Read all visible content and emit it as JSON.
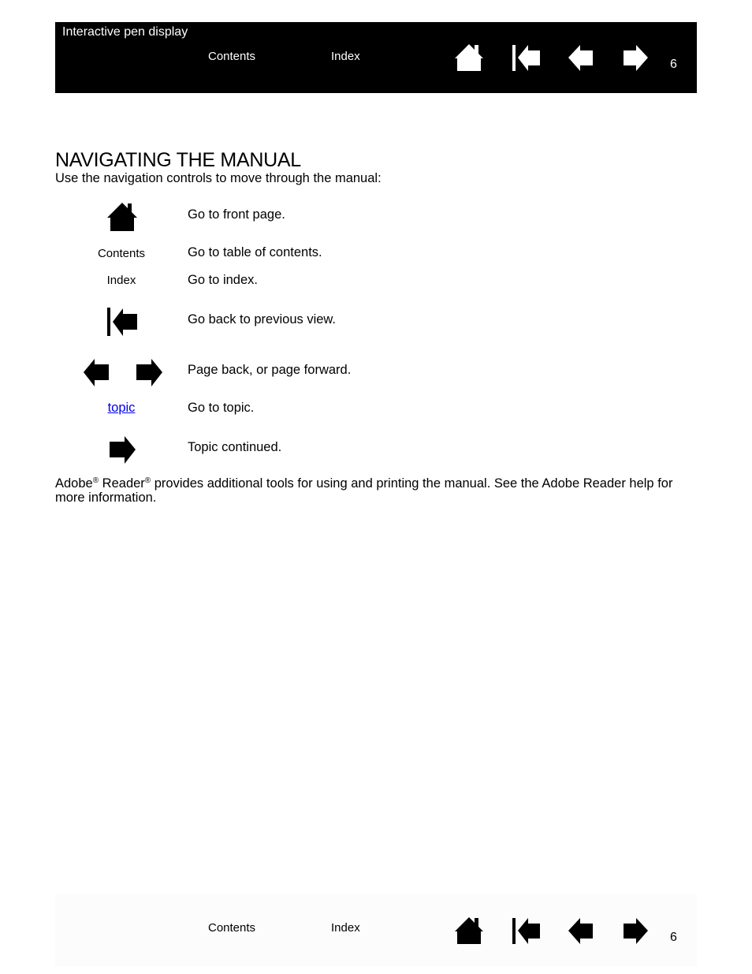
{
  "header": {
    "title": "Interactive pen display",
    "contents_label": "Contents",
    "index_label": "Index",
    "icons": [
      "home-icon",
      "back-view-icon",
      "previous-page-icon",
      "next-page-icon"
    ],
    "page_number": "6"
  },
  "main": {
    "heading": "NAVIGATING THE MANUAL",
    "intro": "Use the navigation controls to move through the manual:",
    "rows": [
      {
        "control": "home-icon",
        "description": "Go to front page."
      },
      {
        "control": "Contents",
        "description": "Go to table of contents."
      },
      {
        "control": "Index",
        "description": "Go to index."
      },
      {
        "control": "back-view-icon",
        "description": "Go back to previous view."
      },
      {
        "control": "previous-next-page-icons",
        "description": "Page back, or page forward."
      },
      {
        "control": "topic",
        "description": "Go to topic."
      },
      {
        "control": "topic-continued-icon",
        "description": "Topic continued."
      }
    ],
    "footnote": {
      "part1": "Adobe",
      "reg1": "®",
      "part2": " Reader",
      "reg2": "®",
      "part3": " provides additional tools for using and printing the manual.  See the Adobe Reader help for more information."
    },
    "link_color": "#0000ee"
  },
  "footer": {
    "contents_label": "Contents",
    "index_label": "Index",
    "icons": [
      "home-icon",
      "back-view-icon",
      "previous-page-icon",
      "next-page-icon"
    ],
    "page_number": "6"
  }
}
